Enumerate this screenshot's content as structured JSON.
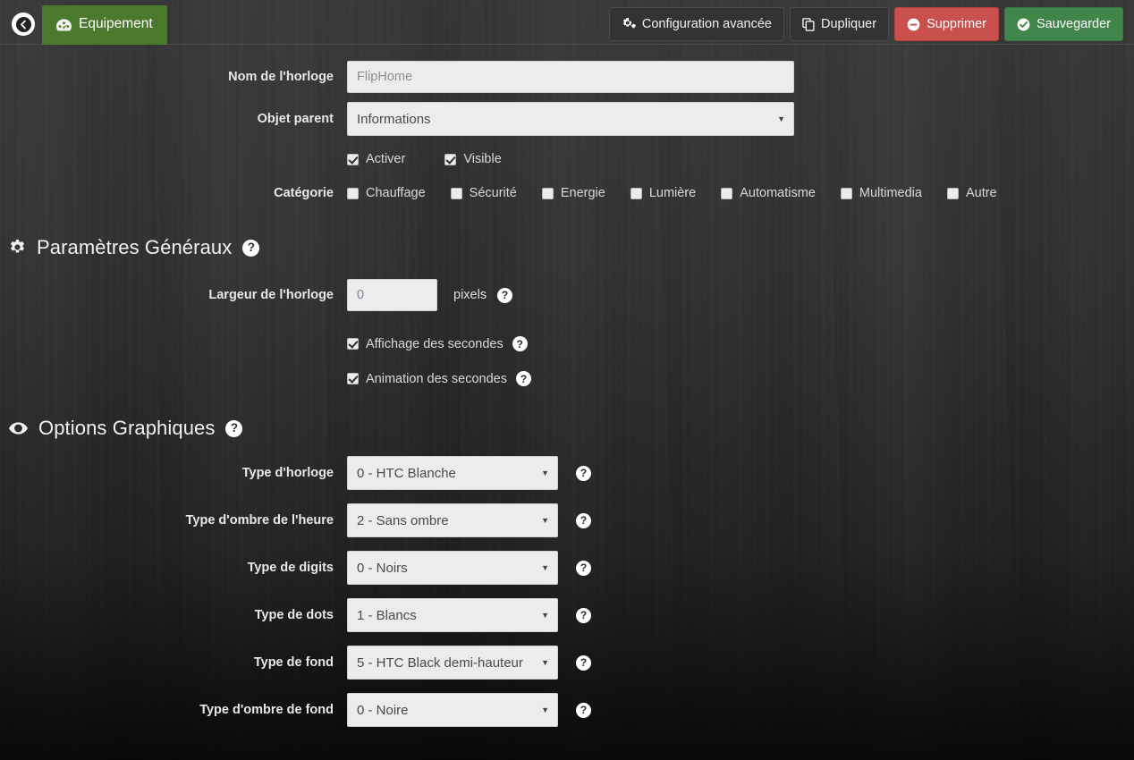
{
  "topbar": {
    "back_label": "",
    "tab": {
      "label": "Equipement",
      "icon": "dashboard-icon"
    },
    "buttons": [
      {
        "label": "Configuration avancée",
        "icon": "gears-icon",
        "style": "default"
      },
      {
        "label": "Dupliquer",
        "icon": "copy-icon",
        "style": "default"
      },
      {
        "label": "Supprimer",
        "icon": "minus-circle-icon",
        "style": "danger"
      },
      {
        "label": "Sauvegarder",
        "icon": "check-circle-icon",
        "style": "success"
      }
    ]
  },
  "form": {
    "name": {
      "label": "Nom de l'horloge",
      "value": "FlipHome",
      "placeholder": "Nom de l'horloge"
    },
    "parent": {
      "label": "Objet parent",
      "value": "Informations"
    },
    "toggles": [
      {
        "label": "Activer",
        "checked": true
      },
      {
        "label": "Visible",
        "checked": true
      }
    ],
    "category": {
      "label": "Catégorie",
      "items": [
        {
          "label": "Chauffage",
          "checked": false
        },
        {
          "label": "Sécurité",
          "checked": false
        },
        {
          "label": "Energie",
          "checked": false
        },
        {
          "label": "Lumière",
          "checked": false
        },
        {
          "label": "Automatisme",
          "checked": false
        },
        {
          "label": "Multimedia",
          "checked": false
        },
        {
          "label": "Autre",
          "checked": false
        }
      ]
    }
  },
  "general": {
    "title": "Paramètres Généraux",
    "icon": "gear-icon",
    "help": "?",
    "width": {
      "label": "Largeur de l'horloge",
      "value": "0",
      "placeholder": "0",
      "unit": "pixels",
      "help": "?"
    },
    "checkboxes": [
      {
        "label": "Affichage des secondes",
        "checked": true,
        "help": "?"
      },
      {
        "label": "Animation des secondes",
        "checked": true,
        "help": "?"
      }
    ]
  },
  "graphics": {
    "title": "Options Graphiques",
    "icon": "eye-icon",
    "help": "?",
    "selects": [
      {
        "label": "Type d'horloge",
        "value": "0 - HTC Blanche",
        "help": "?"
      },
      {
        "label": "Type d'ombre de l'heure",
        "value": "2 - Sans ombre",
        "help": "?"
      },
      {
        "label": "Type de digits",
        "value": "0 - Noirs",
        "help": "?"
      },
      {
        "label": "Type de dots",
        "value": "1 - Blancs",
        "help": "?"
      },
      {
        "label": "Type de fond",
        "value": "5 - HTC Black demi-hauteur",
        "help": "?"
      },
      {
        "label": "Type d'ombre de fond",
        "value": "0 - Noire",
        "help": "?"
      }
    ]
  },
  "colors": {
    "green": "#4b7a2f",
    "save_green": "#40864a",
    "danger_red": "#c9504c",
    "input_bg": "#ececec"
  }
}
